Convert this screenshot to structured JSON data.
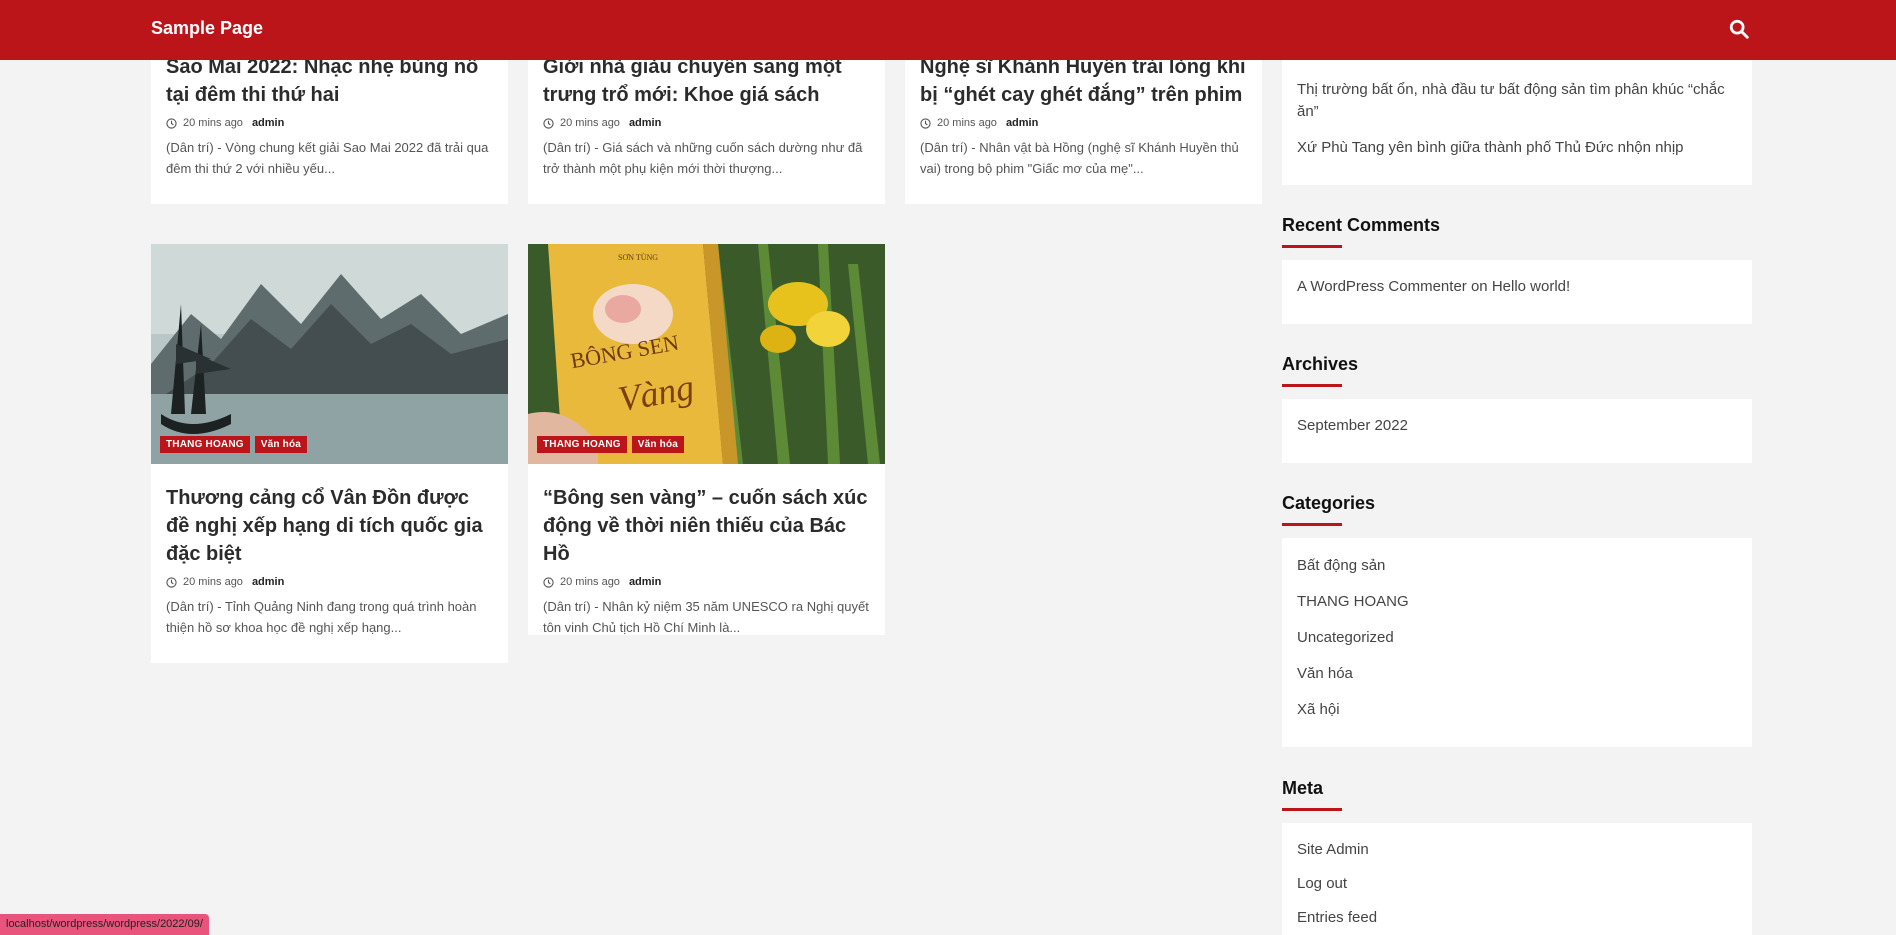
{
  "header": {
    "site_title": "Sample Page"
  },
  "posts_top": [
    {
      "title": "Sao Mai 2022: Nhạc nhẹ bùng nổ tại đêm thi thứ hai",
      "time": "20 mins ago",
      "author": "admin",
      "excerpt": "(Dân trí) - Vòng chung kết giải Sao Mai 2022 đã trải qua đêm thi thứ 2 với nhiều yếu..."
    },
    {
      "title": "Giới nhà giàu chuyển sang một trưng trổ mới: Khoe giá sách",
      "time": "20 mins ago",
      "author": "admin",
      "excerpt": "(Dân trí) - Giá sách và những cuốn sách dường như đã trở thành một phụ kiện mới thời thượng..."
    },
    {
      "title": "Nghệ sĩ Khánh Huyền trải lòng khi bị “ghét cay ghét đắng” trên phim",
      "time": "20 mins ago",
      "author": "admin",
      "excerpt": "(Dân trí) - Nhân vật bà Hồng (nghệ sĩ Khánh Huyền thủ vai) trong bộ phim \"Giấc mơ của mẹ\"..."
    }
  ],
  "posts_bottom": [
    {
      "tags": [
        "THANG HOANG",
        "Văn hóa"
      ],
      "title": "Thương cảng cổ Vân Đồn được đề nghị xếp hạng di tích quốc gia đặc biệt",
      "time": "20 mins ago",
      "author": "admin",
      "excerpt": "(Dân trí) - Tỉnh Quảng Ninh đang trong quá trình hoàn thiện hồ sơ khoa học đề nghị xếp hạng..."
    },
    {
      "tags": [
        "THANG HOANG",
        "Văn hóa"
      ],
      "title": "“Bông sen vàng” – cuốn sách xúc động về thời niên thiếu của Bác Hồ",
      "time": "20 mins ago",
      "author": "admin",
      "excerpt": "(Dân trí) - Nhân kỷ niệm 35 năm UNESCO ra Nghị quyết tôn vinh Chủ tịch Hồ Chí Minh là...",
      "book_author": "SƠN TÙNG",
      "book_title_1": "BÔNG SEN",
      "book_title_2": "Vàng"
    }
  ],
  "sidebar": {
    "recent_posts": [
      "Thị trường bất ổn, nhà đầu tư bất động sản tìm phân khúc “chắc ăn”",
      "Xứ Phù Tang yên bình giữa thành phố Thủ Đức nhộn nhịp"
    ],
    "recent_comments_title": "Recent Comments",
    "comment": {
      "author": "A WordPress Commenter",
      "on": "on",
      "post": "Hello world!"
    },
    "archives_title": "Archives",
    "archives": [
      "September 2022"
    ],
    "categories_title": "Categories",
    "categories": [
      "Bất động sản",
      "THANG HOANG",
      "Uncategorized",
      "Văn hóa",
      "Xã hội"
    ],
    "meta_title": "Meta",
    "meta": [
      "Site Admin",
      "Log out",
      "Entries feed"
    ]
  },
  "status_url": "localhost/wordpress/wordpress/2022/09/",
  "colors": {
    "brand_red": "#bb151a",
    "status_pink": "#e8547b"
  }
}
